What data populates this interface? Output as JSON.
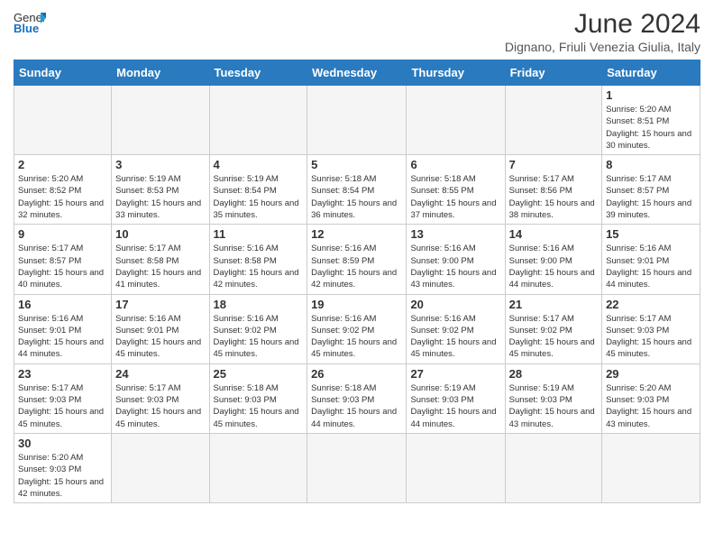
{
  "header": {
    "logo_general": "General",
    "logo_blue": "Blue",
    "title": "June 2024",
    "subtitle": "Dignano, Friuli Venezia Giulia, Italy"
  },
  "days_of_week": [
    "Sunday",
    "Monday",
    "Tuesday",
    "Wednesday",
    "Thursday",
    "Friday",
    "Saturday"
  ],
  "weeks": [
    [
      {
        "day": "",
        "info": "",
        "empty": true
      },
      {
        "day": "",
        "info": "",
        "empty": true
      },
      {
        "day": "",
        "info": "",
        "empty": true
      },
      {
        "day": "",
        "info": "",
        "empty": true
      },
      {
        "day": "",
        "info": "",
        "empty": true
      },
      {
        "day": "",
        "info": "",
        "empty": true
      },
      {
        "day": "1",
        "info": "Sunrise: 5:20 AM\nSunset: 8:51 PM\nDaylight: 15 hours\nand 30 minutes.",
        "empty": false
      }
    ],
    [
      {
        "day": "2",
        "info": "Sunrise: 5:20 AM\nSunset: 8:52 PM\nDaylight: 15 hours\nand 32 minutes.",
        "empty": false
      },
      {
        "day": "3",
        "info": "Sunrise: 5:19 AM\nSunset: 8:53 PM\nDaylight: 15 hours\nand 33 minutes.",
        "empty": false
      },
      {
        "day": "4",
        "info": "Sunrise: 5:19 AM\nSunset: 8:54 PM\nDaylight: 15 hours\nand 35 minutes.",
        "empty": false
      },
      {
        "day": "5",
        "info": "Sunrise: 5:18 AM\nSunset: 8:54 PM\nDaylight: 15 hours\nand 36 minutes.",
        "empty": false
      },
      {
        "day": "6",
        "info": "Sunrise: 5:18 AM\nSunset: 8:55 PM\nDaylight: 15 hours\nand 37 minutes.",
        "empty": false
      },
      {
        "day": "7",
        "info": "Sunrise: 5:17 AM\nSunset: 8:56 PM\nDaylight: 15 hours\nand 38 minutes.",
        "empty": false
      },
      {
        "day": "8",
        "info": "Sunrise: 5:17 AM\nSunset: 8:57 PM\nDaylight: 15 hours\nand 39 minutes.",
        "empty": false
      }
    ],
    [
      {
        "day": "9",
        "info": "Sunrise: 5:17 AM\nSunset: 8:57 PM\nDaylight: 15 hours\nand 40 minutes.",
        "empty": false
      },
      {
        "day": "10",
        "info": "Sunrise: 5:17 AM\nSunset: 8:58 PM\nDaylight: 15 hours\nand 41 minutes.",
        "empty": false
      },
      {
        "day": "11",
        "info": "Sunrise: 5:16 AM\nSunset: 8:58 PM\nDaylight: 15 hours\nand 42 minutes.",
        "empty": false
      },
      {
        "day": "12",
        "info": "Sunrise: 5:16 AM\nSunset: 8:59 PM\nDaylight: 15 hours\nand 42 minutes.",
        "empty": false
      },
      {
        "day": "13",
        "info": "Sunrise: 5:16 AM\nSunset: 9:00 PM\nDaylight: 15 hours\nand 43 minutes.",
        "empty": false
      },
      {
        "day": "14",
        "info": "Sunrise: 5:16 AM\nSunset: 9:00 PM\nDaylight: 15 hours\nand 44 minutes.",
        "empty": false
      },
      {
        "day": "15",
        "info": "Sunrise: 5:16 AM\nSunset: 9:01 PM\nDaylight: 15 hours\nand 44 minutes.",
        "empty": false
      }
    ],
    [
      {
        "day": "16",
        "info": "Sunrise: 5:16 AM\nSunset: 9:01 PM\nDaylight: 15 hours\nand 44 minutes.",
        "empty": false
      },
      {
        "day": "17",
        "info": "Sunrise: 5:16 AM\nSunset: 9:01 PM\nDaylight: 15 hours\nand 45 minutes.",
        "empty": false
      },
      {
        "day": "18",
        "info": "Sunrise: 5:16 AM\nSunset: 9:02 PM\nDaylight: 15 hours\nand 45 minutes.",
        "empty": false
      },
      {
        "day": "19",
        "info": "Sunrise: 5:16 AM\nSunset: 9:02 PM\nDaylight: 15 hours\nand 45 minutes.",
        "empty": false
      },
      {
        "day": "20",
        "info": "Sunrise: 5:16 AM\nSunset: 9:02 PM\nDaylight: 15 hours\nand 45 minutes.",
        "empty": false
      },
      {
        "day": "21",
        "info": "Sunrise: 5:17 AM\nSunset: 9:02 PM\nDaylight: 15 hours\nand 45 minutes.",
        "empty": false
      },
      {
        "day": "22",
        "info": "Sunrise: 5:17 AM\nSunset: 9:03 PM\nDaylight: 15 hours\nand 45 minutes.",
        "empty": false
      }
    ],
    [
      {
        "day": "23",
        "info": "Sunrise: 5:17 AM\nSunset: 9:03 PM\nDaylight: 15 hours\nand 45 minutes.",
        "empty": false
      },
      {
        "day": "24",
        "info": "Sunrise: 5:17 AM\nSunset: 9:03 PM\nDaylight: 15 hours\nand 45 minutes.",
        "empty": false
      },
      {
        "day": "25",
        "info": "Sunrise: 5:18 AM\nSunset: 9:03 PM\nDaylight: 15 hours\nand 45 minutes.",
        "empty": false
      },
      {
        "day": "26",
        "info": "Sunrise: 5:18 AM\nSunset: 9:03 PM\nDaylight: 15 hours\nand 44 minutes.",
        "empty": false
      },
      {
        "day": "27",
        "info": "Sunrise: 5:19 AM\nSunset: 9:03 PM\nDaylight: 15 hours\nand 44 minutes.",
        "empty": false
      },
      {
        "day": "28",
        "info": "Sunrise: 5:19 AM\nSunset: 9:03 PM\nDaylight: 15 hours\nand 43 minutes.",
        "empty": false
      },
      {
        "day": "29",
        "info": "Sunrise: 5:20 AM\nSunset: 9:03 PM\nDaylight: 15 hours\nand 43 minutes.",
        "empty": false
      }
    ],
    [
      {
        "day": "30",
        "info": "Sunrise: 5:20 AM\nSunset: 9:03 PM\nDaylight: 15 hours\nand 42 minutes.",
        "empty": false
      },
      {
        "day": "",
        "info": "",
        "empty": true
      },
      {
        "day": "",
        "info": "",
        "empty": true
      },
      {
        "day": "",
        "info": "",
        "empty": true
      },
      {
        "day": "",
        "info": "",
        "empty": true
      },
      {
        "day": "",
        "info": "",
        "empty": true
      },
      {
        "day": "",
        "info": "",
        "empty": true
      }
    ]
  ]
}
